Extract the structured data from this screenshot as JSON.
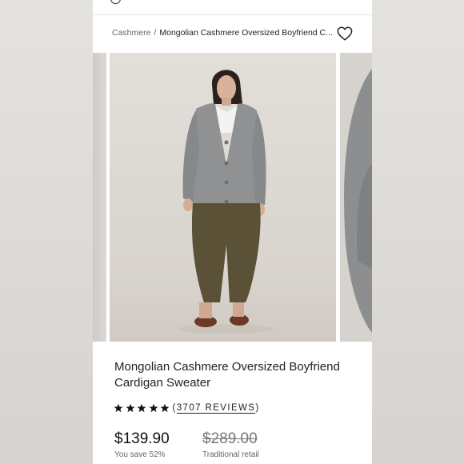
{
  "breadcrumb": {
    "category": "Cashmere",
    "separator": "/",
    "current": "Mongolian Cashmere Oversized Boyfriend C..."
  },
  "icons": {
    "wishlist": "heart-outline-icon",
    "search": "search-icon",
    "rating_star": "star-filled-icon"
  },
  "product": {
    "title": "Mongolian Cashmere Oversized Boyfriend Cardigan Sweater",
    "rating_stars": 5,
    "reviews_open": "(",
    "reviews_label": "3707 REVIEWS",
    "reviews_close": ")",
    "price": "$139.90",
    "savings": "You save 52%",
    "retail_price": "$289.00",
    "retail_label": "Traditional retail"
  },
  "colors": {
    "text": "#222222",
    "muted": "#666666",
    "star": "#111111"
  }
}
